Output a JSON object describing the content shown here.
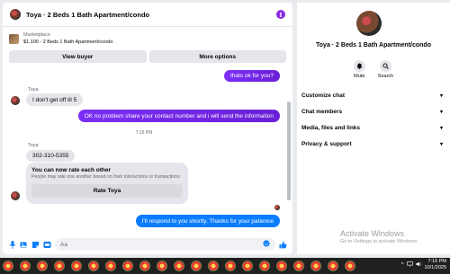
{
  "chat": {
    "title": "Toya · 2 Beds 1 Bath Apartment/condo",
    "listing_source": "Marketplace",
    "listing_title": "$1,100 - 2 Beds 1 Bath Apartment/condo",
    "view_buyer_label": "View buyer",
    "more_options_label": "More options"
  },
  "messages": {
    "msg1": "thats ok for you?",
    "sender1": "Toya",
    "msg2": "I don't get off til 5",
    "msg3": "OK no problem share your contact number and i will send the information",
    "timestamp": "7:15 PM",
    "sender2": "Toya",
    "msg4": "302-310-5355",
    "msg5": "I'll respond to you shortly. Thanks for your patience"
  },
  "rating_card": {
    "title": "You can now rate each other",
    "subtitle": "People may rate one another based on their interactions or transactions.",
    "button_label": "Rate Toya"
  },
  "composer": {
    "placeholder": "Aa"
  },
  "side": {
    "title": "Toya · 2 Beds 1 Bath Apartment/condo",
    "mute_label": "Mute",
    "search_label": "Search",
    "items": [
      {
        "label": "Customize chat"
      },
      {
        "label": "Chat members"
      },
      {
        "label": "Media, files and links"
      },
      {
        "label": "Privacy & support"
      }
    ],
    "watermark_title": "Activate Windows",
    "watermark_sub": "Go to Settings to activate Windows."
  },
  "taskbar": {
    "time": "7:16 PM",
    "date": "10/1/2025"
  }
}
